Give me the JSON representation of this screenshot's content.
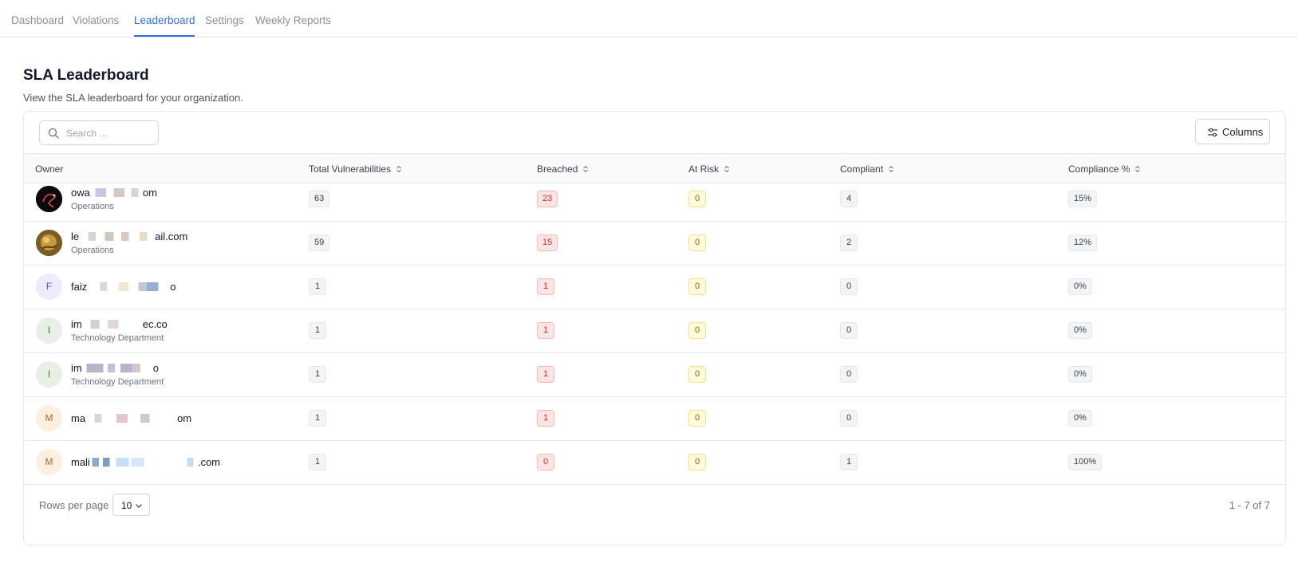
{
  "nav": {
    "tabs": [
      {
        "label": "Dashboard"
      },
      {
        "label": "Violations"
      },
      {
        "label": "Leaderboard"
      },
      {
        "label": "Settings"
      },
      {
        "label": "Weekly Reports"
      }
    ],
    "active_tab": "Leaderboard"
  },
  "page": {
    "title": "SLA Leaderboard",
    "subtitle": "View the SLA leaderboard for your organization."
  },
  "toolbar": {
    "search_placeholder": "Search ...",
    "columns_label": "Columns"
  },
  "table": {
    "headers": {
      "owner": "Owner",
      "total": "Total Vulnerabilities",
      "breached": "Breached",
      "at_risk": "At Risk",
      "compliant": "Compliant",
      "compliance_pct": "Compliance %"
    },
    "rows": [
      {
        "avatar": "",
        "name_start": "owa",
        "name_end": "om",
        "dept": "Operations",
        "total": "63",
        "breached": "23",
        "at_risk": "0",
        "compliant": "4",
        "pct": "15%"
      },
      {
        "avatar": "",
        "name_start": "le",
        "name_end": "ail.com",
        "dept": "Operations",
        "total": "59",
        "breached": "15",
        "at_risk": "0",
        "compliant": "2",
        "pct": "12%"
      },
      {
        "avatar": "F",
        "name_start": "faiz",
        "name_end": "o",
        "dept": "",
        "total": "1",
        "breached": "1",
        "at_risk": "0",
        "compliant": "0",
        "pct": "0%"
      },
      {
        "avatar": "I",
        "name_start": "im",
        "name_end": "ec.co",
        "dept": "Technology Department",
        "total": "1",
        "breached": "1",
        "at_risk": "0",
        "compliant": "0",
        "pct": "0%"
      },
      {
        "avatar": "I",
        "name_start": "im",
        "name_end": "o",
        "dept": "Technology Department",
        "total": "1",
        "breached": "1",
        "at_risk": "0",
        "compliant": "0",
        "pct": "0%"
      },
      {
        "avatar": "M",
        "name_start": "ma",
        "name_end": "om",
        "dept": "",
        "total": "1",
        "breached": "1",
        "at_risk": "0",
        "compliant": "0",
        "pct": "0%"
      },
      {
        "avatar": "M",
        "name_start": "mali",
        "name_end": ".com",
        "dept": "",
        "total": "1",
        "breached": "0",
        "at_risk": "0",
        "compliant": "1",
        "pct": "100%"
      }
    ]
  },
  "pagination": {
    "rows_per_page_label": "Rows per page",
    "rows_per_page_value": "10",
    "range_text": "1 - 7 of 7"
  },
  "colors": {
    "accent": "#2f6fd6",
    "breached_bg": "#fde4e4",
    "at_risk_bg": "#fefadb"
  }
}
